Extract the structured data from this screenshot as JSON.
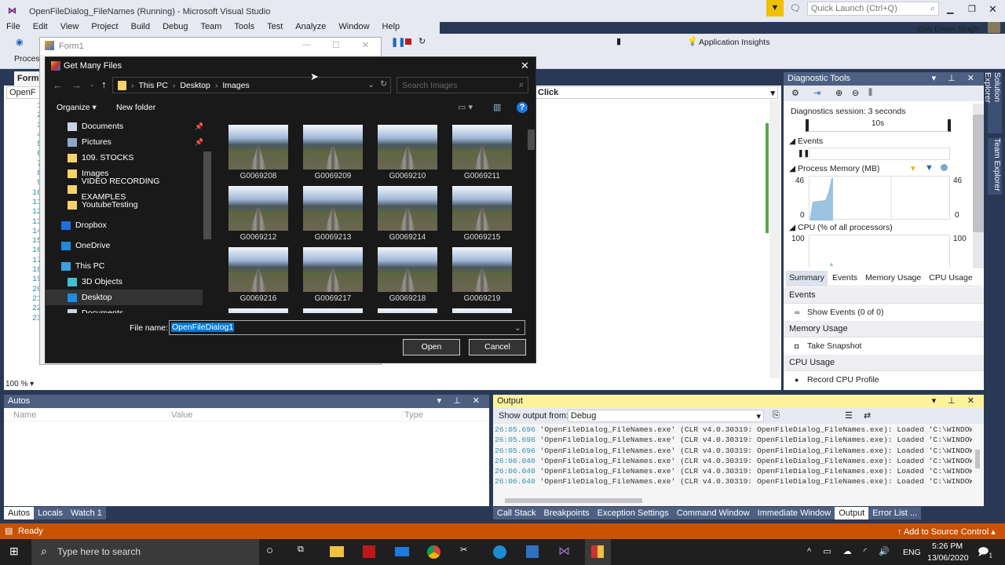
{
  "window": {
    "title": "OpenFileDialog_FileNames (Running) - Microsoft Visual Studio",
    "quick_launch_placeholder": "Quick Launch (Ctrl+Q)",
    "user": "Gus Erwin Singh"
  },
  "menu": [
    "File",
    "Edit",
    "View",
    "Project",
    "Build",
    "Debug",
    "Team",
    "Tools",
    "Test",
    "Analyze",
    "Window",
    "Help"
  ],
  "toolbar": {
    "app_insights": "Application Insights",
    "process_label": "Process"
  },
  "editor": {
    "tab": "Form1",
    "file_dropdown": "OpenF",
    "member_dropdown": "Click",
    "line_numbers": [
      "1",
      "2",
      "3",
      "4",
      "5",
      "6",
      "7",
      "8",
      "9",
      "10",
      "11",
      "12",
      "13",
      "14",
      "15",
      "16",
      "17",
      "18",
      "19",
      "20",
      "21",
      "22",
      "23"
    ],
    "zoom": "100 %"
  },
  "form1": {
    "title": "Form1"
  },
  "dialog": {
    "title": "Get Many Files",
    "breadcrumb": [
      "This PC",
      "Desktop",
      "Images"
    ],
    "search_placeholder": "Search Images",
    "organize": "Organize",
    "new_folder": "New folder",
    "nav": [
      {
        "label": "Documents",
        "icon": "documents-icon",
        "pinned": true
      },
      {
        "label": "Pictures",
        "icon": "pictures-icon",
        "pinned": true
      },
      {
        "label": "109. STOCKS",
        "icon": "folder-icon"
      },
      {
        "label": "Images",
        "icon": "folder-icon"
      },
      {
        "label": "VIDEO RECORDING EXAMPLES",
        "icon": "folder-icon"
      },
      {
        "label": "YoutubeTesting",
        "icon": "folder-icon"
      },
      {
        "label": "Dropbox",
        "icon": "dropbox-icon"
      },
      {
        "label": "OneDrive",
        "icon": "onedrive-icon"
      },
      {
        "label": "This PC",
        "icon": "pc-icon"
      },
      {
        "label": "3D Objects",
        "icon": "3d-objects-icon"
      },
      {
        "label": "Desktop",
        "icon": "desktop-icon",
        "selected": true
      },
      {
        "label": "Documents",
        "icon": "documents-icon"
      }
    ],
    "files": [
      "G0069208",
      "G0069209",
      "G0069210",
      "G0069211",
      "G0069212",
      "G0069213",
      "G0069214",
      "G0069215",
      "G0069216",
      "G0069217",
      "G0069218",
      "G0069219"
    ],
    "file_name_label": "File name:",
    "file_name_value": "OpenFileDialog1",
    "open": "Open",
    "cancel": "Cancel"
  },
  "diagnostics": {
    "title": "Diagnostic Tools",
    "session": "Diagnostics session: 3 seconds",
    "timeline_tick": "10s",
    "events": "Events",
    "memory": "Process Memory (MB)",
    "mem_max": "46",
    "mem_min": "0",
    "cpu": "CPU (% of all processors)",
    "cpu_max": "100",
    "tabs": [
      "Summary",
      "Events",
      "Memory Usage",
      "CPU Usage"
    ],
    "sections": [
      {
        "title": "Events",
        "action": "Show Events (0 of 0)"
      },
      {
        "title": "Memory Usage",
        "action": "Take Snapshot"
      },
      {
        "title": "CPU Usage",
        "action": "Record CPU Profile"
      }
    ]
  },
  "side_tabs": [
    "Solution Explorer",
    "Team Explorer"
  ],
  "autos": {
    "title": "Autos",
    "columns": [
      "Name",
      "Value",
      "Type"
    ],
    "tabs": [
      "Autos",
      "Locals",
      "Watch 1"
    ]
  },
  "output": {
    "title": "Output",
    "show_from_label": "Show output from:",
    "source": "Debug",
    "lines": [
      {
        "t": "26:05.696",
        "msg": "'OpenFileDialog_FileNames.exe' (CLR v4.0.30319: OpenFileDialog_FileNames.exe): Loaded 'C:\\WINDOWS\\Micro"
      },
      {
        "t": "26:05.696",
        "msg": "'OpenFileDialog_FileNames.exe' (CLR v4.0.30319: OpenFileDialog_FileNames.exe): Loaded 'C:\\WINDOWS\\Micro"
      },
      {
        "t": "26:05.696",
        "msg": "'OpenFileDialog_FileNames.exe' (CLR v4.0.30319: OpenFileDialog_FileNames.exe): Loaded 'C:\\WINDOWS\\Micro"
      },
      {
        "t": "26:06.040",
        "msg": "'OpenFileDialog_FileNames.exe' (CLR v4.0.30319: OpenFileDialog_FileNames.exe): Loaded 'C:\\WINDOWS\\Micro"
      },
      {
        "t": "26:06.040",
        "msg": "'OpenFileDialog_FileNames.exe' (CLR v4.0.30319: OpenFileDialog_FileNames.exe): Loaded 'C:\\WINDOWS\\Micro"
      },
      {
        "t": "26:06.040",
        "msg": "'OpenFileDialog_FileNames.exe' (CLR v4.0.30319: OpenFileDialog_FileNames.exe): Loaded 'C:\\WINDOWS\\Micro"
      }
    ],
    "tabs": [
      "Call Stack",
      "Breakpoints",
      "Exception Settings",
      "Command Window",
      "Immediate Window",
      "Output",
      "Error List ..."
    ]
  },
  "status": {
    "text": "Ready",
    "source_control": "Add to Source Control"
  },
  "taskbar": {
    "search": "Type here to search",
    "lang": "ENG",
    "time": "5:26 PM",
    "date": "13/06/2020",
    "notifications": "1"
  },
  "colors": {
    "status_bar": "#ca5100",
    "accent_blue": "#0078d7",
    "output_header": "#fff29d"
  }
}
